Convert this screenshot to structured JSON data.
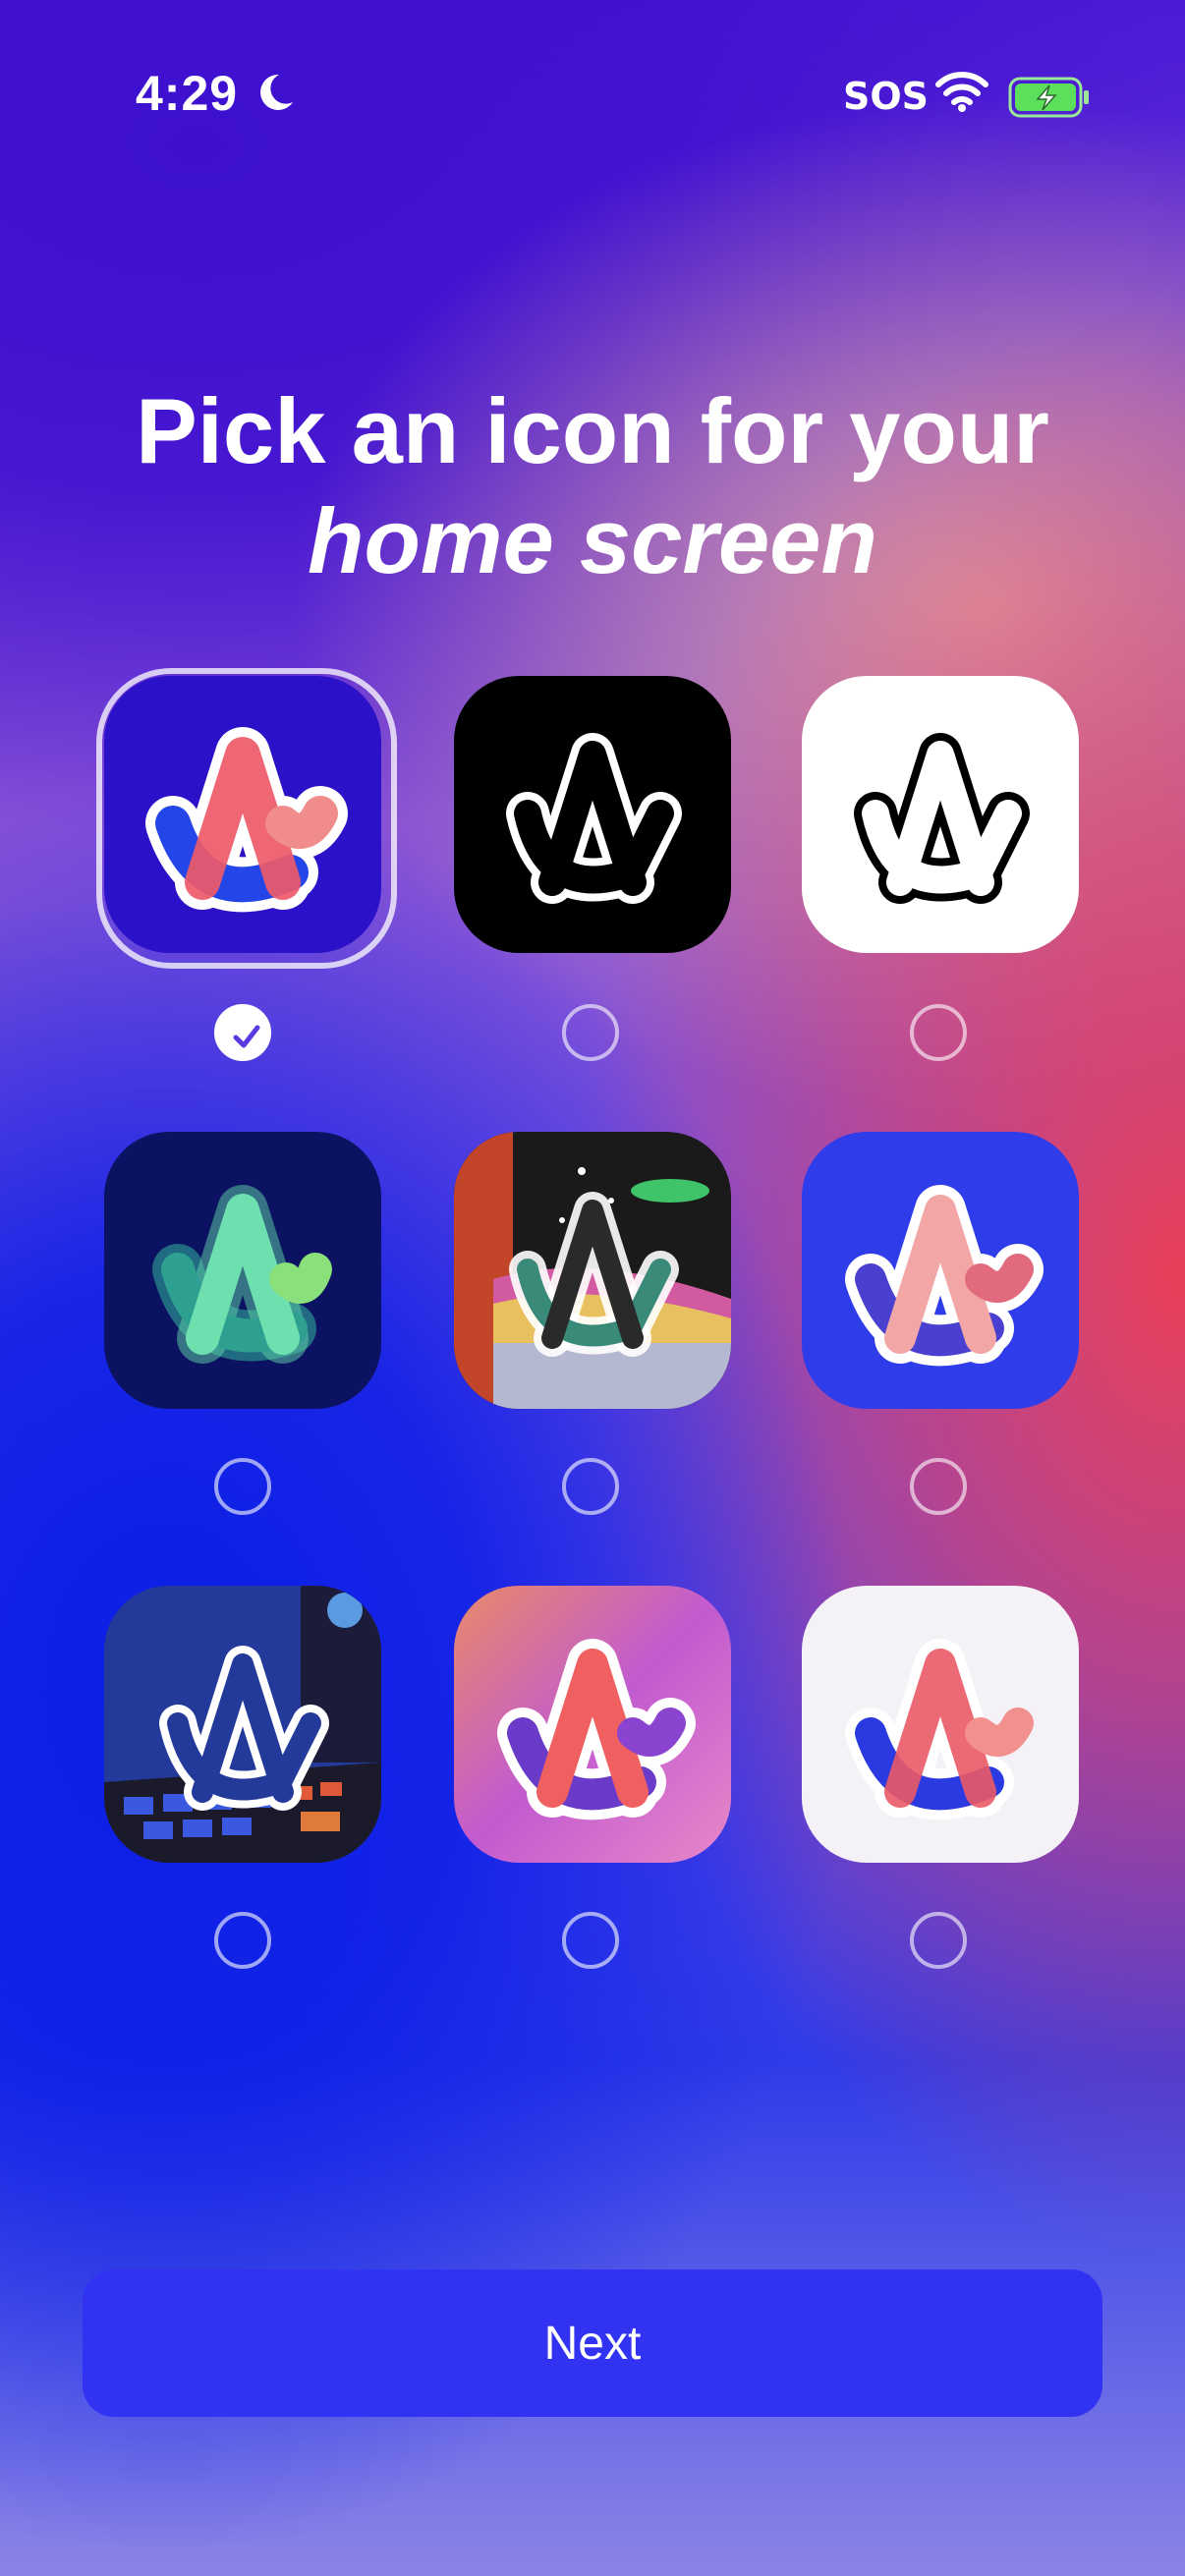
{
  "status_bar": {
    "time": "4:29",
    "focus_icon": "moon-icon",
    "carrier_text": "SOS",
    "wifi_icon": "wifi-icon",
    "battery_icon": "battery-charging-icon",
    "battery_color": "#5ce05c"
  },
  "header": {
    "title_line1": "Pick an icon for your",
    "title_line2": "home screen"
  },
  "icon_options": [
    {
      "name": "arc-default-icon",
      "selected": true
    },
    {
      "name": "arc-black-icon",
      "selected": false
    },
    {
      "name": "arc-white-icon",
      "selected": false
    },
    {
      "name": "arc-glow-icon",
      "selected": false
    },
    {
      "name": "arc-space-icon",
      "selected": false
    },
    {
      "name": "arc-blue-icon",
      "selected": false
    },
    {
      "name": "arc-retro-computer-icon",
      "selected": false
    },
    {
      "name": "arc-gradient-icon",
      "selected": false
    },
    {
      "name": "arc-light-icon",
      "selected": false
    }
  ],
  "footer": {
    "next_label": "Next",
    "accent": "#3132f2"
  }
}
